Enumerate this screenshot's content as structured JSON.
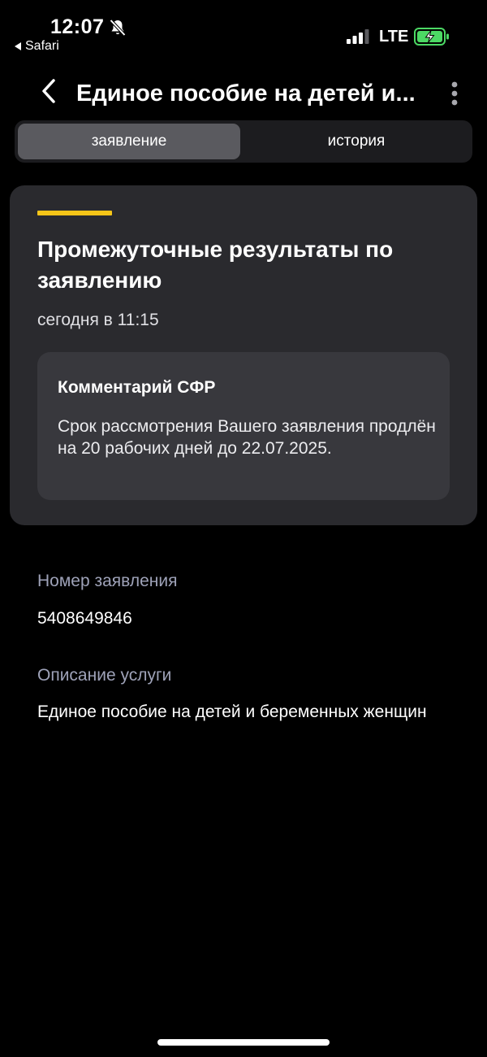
{
  "status_bar": {
    "time": "12:07",
    "back_app": "Safari",
    "network": "LTE",
    "icons": [
      "bell-slash-icon",
      "signal-icon",
      "battery-charging-icon"
    ],
    "battery_color": "#4cd964"
  },
  "nav": {
    "title": "Единое пособие на детей и...",
    "icons": [
      "chevron-left-icon",
      "more-vertical-icon"
    ]
  },
  "tabs": [
    {
      "label": "заявление",
      "selected": true
    },
    {
      "label": "история",
      "selected": false
    }
  ],
  "card": {
    "accent_color": "#f5c518",
    "title": "Промежуточные результаты по заявлению",
    "date": "сегодня в 11:15",
    "comment": {
      "title": "Комментарий СФР",
      "text": "Срок рассмотрения Вашего заявления продлён на 20 рабочих дней до 22.07.2025."
    }
  },
  "details": [
    {
      "label": "Номер заявления",
      "value": "5408649846"
    },
    {
      "label": "Описание услуги",
      "value": "Единое пособие на детей и беременных женщин"
    }
  ]
}
